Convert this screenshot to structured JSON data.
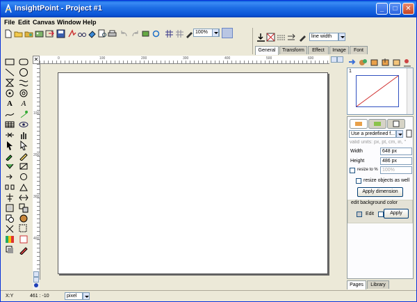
{
  "window": {
    "title": "InsightPoint - Project #1",
    "min_label": "_",
    "max_label": "□",
    "close_label": "✕"
  },
  "menu": [
    "File",
    "Edit",
    "Canvas",
    "Window",
    "Help"
  ],
  "toolbar": {
    "zoom_value": "100%"
  },
  "props_toolbar": {
    "line_width_label": "line width"
  },
  "props_tabs": [
    "General",
    "Transform",
    "Effect",
    "Image",
    "Font"
  ],
  "ruler": {
    "h_ticks": [
      "0",
      "100",
      "200",
      "300",
      "400",
      "500",
      "600"
    ],
    "v_ticks": [
      "100",
      "200",
      "300",
      "400"
    ]
  },
  "preview": {
    "page_number": "1"
  },
  "page_props": {
    "preset_label": "Use a predefined f...",
    "units_hint": "valid units: px, pt, cm, in, \"",
    "width_label": "Width",
    "width_value": "648 px",
    "height_label": "Height",
    "height_value": "486 px",
    "resize_label": "resize to %",
    "resize_value": "100%",
    "resize_objects_label": "resize objects as well",
    "apply_dimension_label": "Apply dimension",
    "bg_group_label": "edit background color",
    "edit_label": "Edit",
    "apply_label": "Apply"
  },
  "bottom_tabs": [
    "Pages",
    "Library"
  ],
  "status": {
    "coord_label": "X:Y",
    "coord_value": "461 : -10",
    "unit_value": "pixel"
  },
  "colors": {
    "title_blue": "#0a55d6",
    "window_bg": "#ece9d8",
    "preview_line": "#d03030"
  }
}
